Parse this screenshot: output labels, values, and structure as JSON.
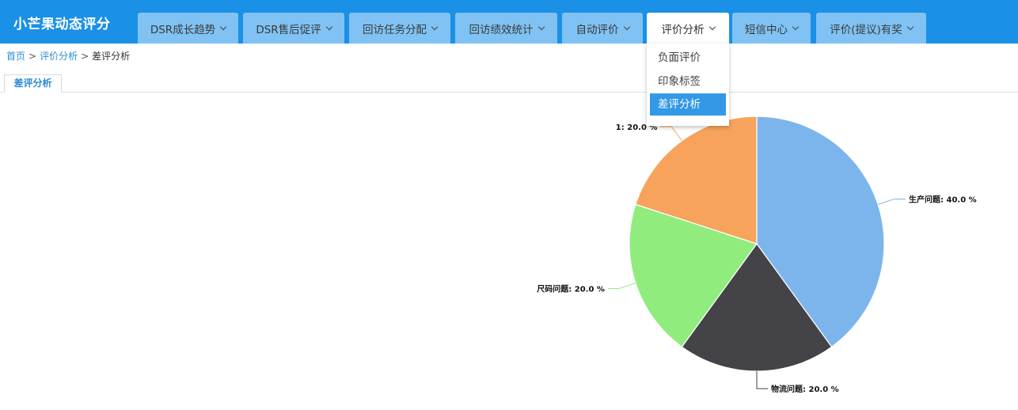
{
  "app": {
    "title": "小芒果动态评分"
  },
  "nav": {
    "items": [
      {
        "label": "DSR成长趋势"
      },
      {
        "label": "DSR售后促评"
      },
      {
        "label": "回访任务分配"
      },
      {
        "label": "回访绩效统计"
      },
      {
        "label": "自动评价"
      },
      {
        "label": "评价分析"
      },
      {
        "label": "短信中心"
      },
      {
        "label": "评价(提议)有奖"
      }
    ],
    "active": "评价分析",
    "dropdown": [
      {
        "label": "负面评价"
      },
      {
        "label": "印象标签"
      },
      {
        "label": "差评分析",
        "selected": true
      }
    ]
  },
  "breadcrumb": {
    "home": "首页",
    "sep": ">",
    "parent": "评价分析",
    "current": "差评分析"
  },
  "tab": {
    "label": "差评分析"
  },
  "chart_data": {
    "type": "pie",
    "slices": [
      {
        "name": "生产问题",
        "value": 40.0,
        "color": "#7cb5ec",
        "label": "生产问题: 40.0 %"
      },
      {
        "name": "物流问题",
        "value": 20.0,
        "color": "#434348",
        "label": "物流问题: 20.0 %"
      },
      {
        "name": "尺码问题",
        "value": 20.0,
        "color": "#90ed7d",
        "label": "尺码问题: 20.0 %"
      },
      {
        "name": "",
        "value": 20.0,
        "color": "#f7a35c",
        "label": "1: 20.0 %"
      }
    ]
  }
}
